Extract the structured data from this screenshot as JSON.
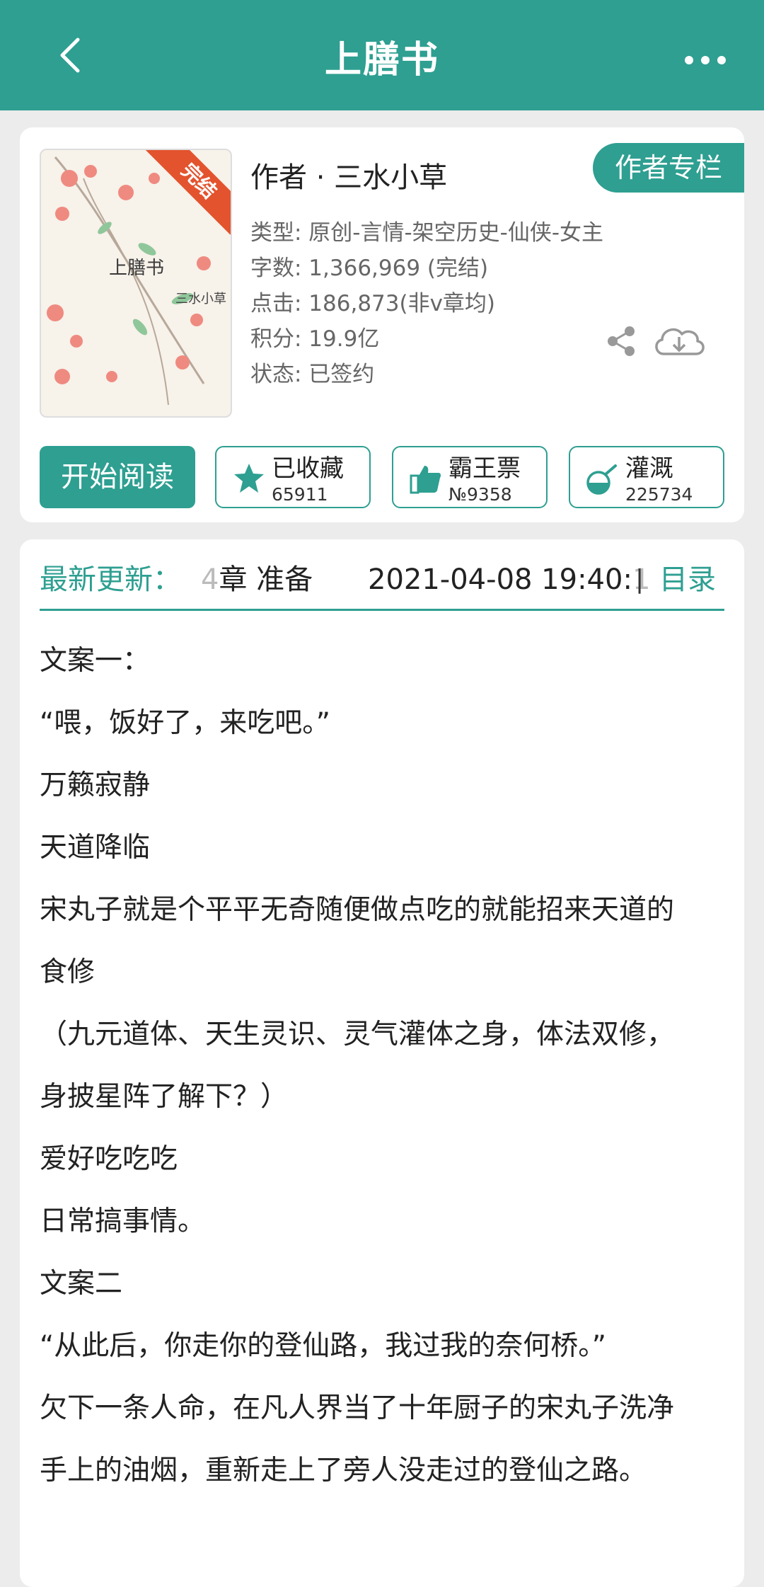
{
  "header": {
    "title": "上膳书",
    "back_icon": "chevron-left-icon",
    "more_icon": "more-dots-icon"
  },
  "book": {
    "cover_badge": "完结",
    "cover_title": "上膳书",
    "cover_author": "三水小草",
    "author": "作者 · 三水小草",
    "author_column_button": "作者专栏",
    "meta": [
      "类型: 原创-言情-架空历史-仙侠-女主",
      "字数: 1,366,969 (完结)",
      "点击: 186,873(非v章均)",
      "积分: 19.9亿",
      "状态: 已签约"
    ]
  },
  "actions": {
    "read": "开始阅读",
    "favorite": {
      "label": "已收藏",
      "value": "65911"
    },
    "ticket": {
      "label": "霸王票",
      "value": "№9358"
    },
    "nutrient": {
      "label": "灌溉",
      "value": "225734"
    }
  },
  "latest": {
    "label": "最新更新：",
    "chapter_prefix": "4",
    "chapter": "章   准备",
    "time_main": "2021-04-08  19:40:",
    "time_faded": "1",
    "separator": "|",
    "toc": "目录"
  },
  "description": [
    "文案一：",
    "“喂，饭好了，来吃吧。”",
    "万籁寂静",
    "天道降临",
    "宋丸子就是个平平无奇随便做点吃的就能招来天道的",
    "食修",
    "（九元道体、天生灵识、灵气灌体之身，体法双修，",
    "身披星阵了解下？）",
    "爱好吃吃吃",
    "日常搞事情。",
    "文案二",
    "“从此后，你走你的登仙路，我过我的奈何桥。”",
    "欠下一条人命，在凡人界当了十年厨子的宋丸子洗净",
    "手上的油烟，重新走上了旁人没走过的登仙之路。"
  ],
  "colors": {
    "accent": "#2e9f91",
    "badge": "#e3532d"
  }
}
